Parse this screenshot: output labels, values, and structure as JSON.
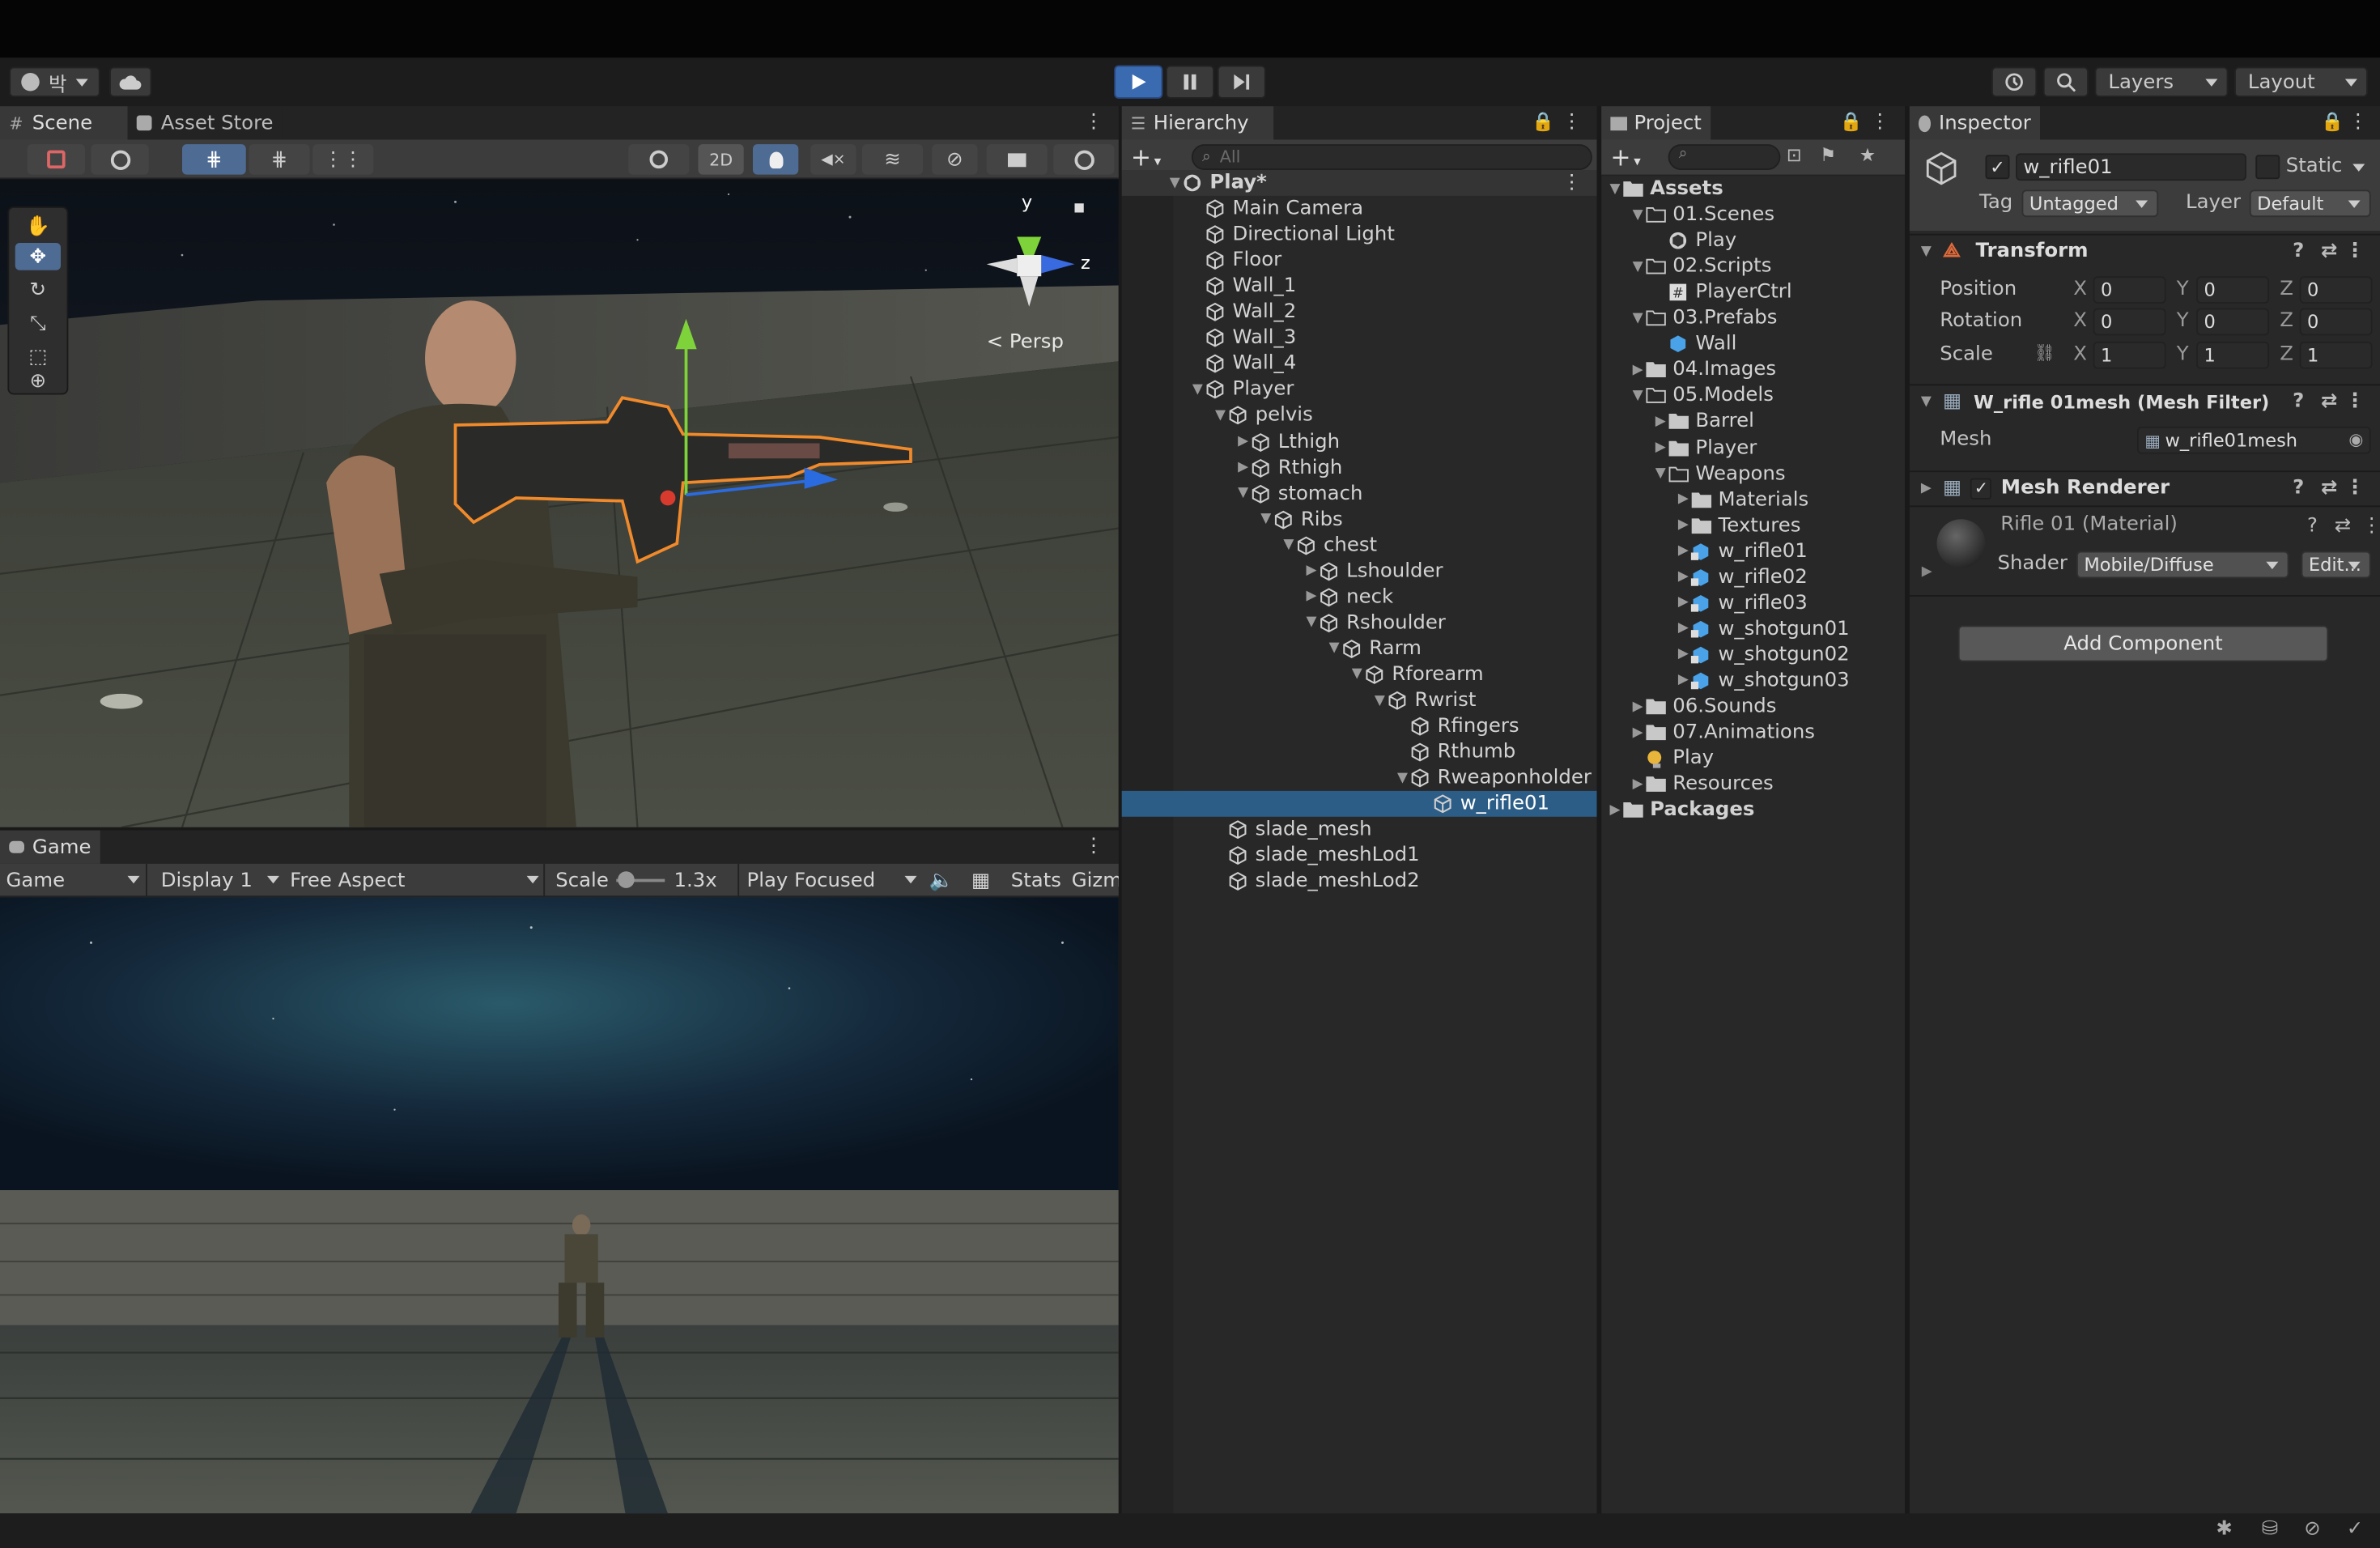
{
  "toolbar": {
    "account_label": "박",
    "layers": "Layers",
    "layout": "Layout"
  },
  "scene": {
    "tab": "Scene",
    "asset_store_tab": "Asset Store",
    "persp": "< Persp",
    "axis_y": "y",
    "axis_z": "z",
    "toggle_2d": "2D"
  },
  "game": {
    "tab": "Game",
    "view_mode": "Game",
    "display": "Display 1",
    "aspect": "Free Aspect",
    "scale_label": "Scale",
    "scale_value": "1.3x",
    "play_mode": "Play Focused",
    "stats": "Stats",
    "gizmos": "Gizm"
  },
  "hierarchy": {
    "tab": "Hierarchy",
    "search_placeholder": "All",
    "items": [
      {
        "label": "Play*",
        "depth": 0,
        "arrow": "open",
        "icon": "unity"
      },
      {
        "label": "Main Camera",
        "depth": 1,
        "arrow": "",
        "icon": "cube"
      },
      {
        "label": "Directional Light",
        "depth": 1,
        "arrow": "",
        "icon": "cube"
      },
      {
        "label": "Floor",
        "depth": 1,
        "arrow": "",
        "icon": "cube"
      },
      {
        "label": "Wall_1",
        "depth": 1,
        "arrow": "",
        "icon": "cube"
      },
      {
        "label": "Wall_2",
        "depth": 1,
        "arrow": "",
        "icon": "cube"
      },
      {
        "label": "Wall_3",
        "depth": 1,
        "arrow": "",
        "icon": "cube"
      },
      {
        "label": "Wall_4",
        "depth": 1,
        "arrow": "",
        "icon": "cube"
      },
      {
        "label": "Player",
        "depth": 1,
        "arrow": "open",
        "icon": "cube"
      },
      {
        "label": "pelvis",
        "depth": 2,
        "arrow": "open",
        "icon": "cube"
      },
      {
        "label": "Lthigh",
        "depth": 3,
        "arrow": "closed",
        "icon": "cube"
      },
      {
        "label": "Rthigh",
        "depth": 3,
        "arrow": "closed",
        "icon": "cube"
      },
      {
        "label": "stomach",
        "depth": 3,
        "arrow": "open",
        "icon": "cube"
      },
      {
        "label": "Ribs",
        "depth": 4,
        "arrow": "open",
        "icon": "cube"
      },
      {
        "label": "chest",
        "depth": 5,
        "arrow": "open",
        "icon": "cube"
      },
      {
        "label": "Lshoulder",
        "depth": 6,
        "arrow": "closed",
        "icon": "cube"
      },
      {
        "label": "neck",
        "depth": 6,
        "arrow": "closed",
        "icon": "cube"
      },
      {
        "label": "Rshoulder",
        "depth": 6,
        "arrow": "open",
        "icon": "cube"
      },
      {
        "label": "Rarm",
        "depth": 7,
        "arrow": "open",
        "icon": "cube"
      },
      {
        "label": "Rforearm",
        "depth": 8,
        "arrow": "open",
        "icon": "cube"
      },
      {
        "label": "Rwrist",
        "depth": 9,
        "arrow": "open",
        "icon": "cube"
      },
      {
        "label": "Rfingers",
        "depth": 10,
        "arrow": "",
        "icon": "cube"
      },
      {
        "label": "Rthumb",
        "depth": 10,
        "arrow": "",
        "icon": "cube"
      },
      {
        "label": "Rweaponholder",
        "depth": 10,
        "arrow": "open",
        "icon": "cube"
      },
      {
        "label": "w_rifle01",
        "depth": 11,
        "arrow": "",
        "icon": "cube",
        "selected": true
      },
      {
        "label": "slade_mesh",
        "depth": 2,
        "arrow": "",
        "icon": "cube"
      },
      {
        "label": "slade_meshLod1",
        "depth": 2,
        "arrow": "",
        "icon": "cube"
      },
      {
        "label": "slade_meshLod2",
        "depth": 2,
        "arrow": "",
        "icon": "cube"
      }
    ]
  },
  "project": {
    "tab": "Project",
    "items": [
      {
        "label": "Assets",
        "depth": 0,
        "arrow": "open",
        "icon": "folder",
        "bold": true
      },
      {
        "label": "01.Scenes",
        "depth": 1,
        "arrow": "open",
        "icon": "folder-open"
      },
      {
        "label": "Play",
        "depth": 2,
        "arrow": "",
        "icon": "unity"
      },
      {
        "label": "02.Scripts",
        "depth": 1,
        "arrow": "open",
        "icon": "folder-open"
      },
      {
        "label": "PlayerCtrl",
        "depth": 2,
        "arrow": "",
        "icon": "script"
      },
      {
        "label": "03.Prefabs",
        "depth": 1,
        "arrow": "open",
        "icon": "folder-open"
      },
      {
        "label": "Wall",
        "depth": 2,
        "arrow": "",
        "icon": "prefab"
      },
      {
        "label": "04.Images",
        "depth": 1,
        "arrow": "closed",
        "icon": "folder"
      },
      {
        "label": "05.Models",
        "depth": 1,
        "arrow": "open",
        "icon": "folder-open"
      },
      {
        "label": "Barrel",
        "depth": 2,
        "arrow": "closed",
        "icon": "folder"
      },
      {
        "label": "Player",
        "depth": 2,
        "arrow": "closed",
        "icon": "folder"
      },
      {
        "label": "Weapons",
        "depth": 2,
        "arrow": "open",
        "icon": "folder-open"
      },
      {
        "label": "Materials",
        "depth": 3,
        "arrow": "closed",
        "icon": "folder"
      },
      {
        "label": "Textures",
        "depth": 3,
        "arrow": "closed",
        "icon": "folder"
      },
      {
        "label": "w_rifle01",
        "depth": 3,
        "arrow": "closed",
        "icon": "model"
      },
      {
        "label": "w_rifle02",
        "depth": 3,
        "arrow": "closed",
        "icon": "model"
      },
      {
        "label": "w_rifle03",
        "depth": 3,
        "arrow": "closed",
        "icon": "model"
      },
      {
        "label": "w_shotgun01",
        "depth": 3,
        "arrow": "closed",
        "icon": "model"
      },
      {
        "label": "w_shotgun02",
        "depth": 3,
        "arrow": "closed",
        "icon": "model"
      },
      {
        "label": "w_shotgun03",
        "depth": 3,
        "arrow": "closed",
        "icon": "model"
      },
      {
        "label": "06.Sounds",
        "depth": 1,
        "arrow": "closed",
        "icon": "folder"
      },
      {
        "label": "07.Animations",
        "depth": 1,
        "arrow": "closed",
        "icon": "folder"
      },
      {
        "label": "Play",
        "depth": 1,
        "arrow": "",
        "icon": "lighting"
      },
      {
        "label": "Resources",
        "depth": 1,
        "arrow": "closed",
        "icon": "folder"
      },
      {
        "label": "Packages",
        "depth": 0,
        "arrow": "closed",
        "icon": "folder",
        "bold": true
      }
    ]
  },
  "inspector": {
    "tab": "Inspector",
    "object_name": "w_rifle01",
    "static_label": "Static",
    "tag_label": "Tag",
    "tag_value": "Untagged",
    "layer_label": "Layer",
    "layer_value": "Default",
    "transform": {
      "title": "Transform",
      "position_label": "Position",
      "rotation_label": "Rotation",
      "scale_label": "Scale",
      "position": {
        "x": "0",
        "y": "0",
        "z": "0"
      },
      "rotation": {
        "x": "0",
        "y": "0",
        "z": "0"
      },
      "scale": {
        "x": "1",
        "y": "1",
        "z": "1"
      },
      "x": "X",
      "y": "Y",
      "z": "Z"
    },
    "mesh_filter": {
      "title": "W_rifle 01mesh (Mesh Filter)",
      "mesh_label": "Mesh",
      "mesh_value": "w_rifle01mesh"
    },
    "mesh_renderer": {
      "title": "Mesh Renderer"
    },
    "material": {
      "name": "Rifle 01 (Material)",
      "shader_label": "Shader",
      "shader_value": "Mobile/Diffuse",
      "edit_label": "Edit..."
    },
    "add_component": "Add Component"
  },
  "colors": {
    "play_blue": "#3a6ab0",
    "selection": "#2c5d87",
    "accent_orange": "#f08a2b"
  }
}
